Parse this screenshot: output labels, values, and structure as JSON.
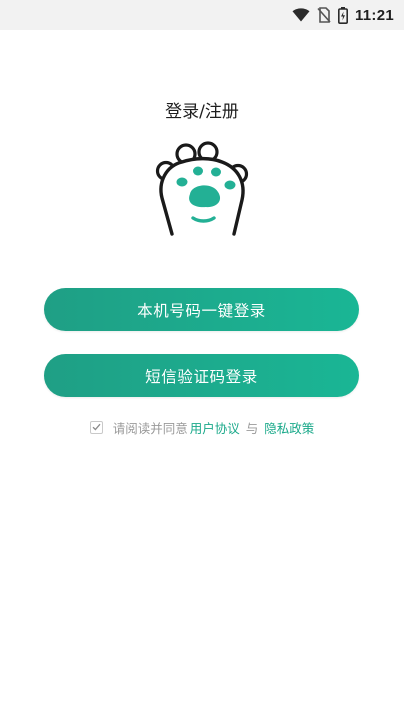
{
  "status_bar": {
    "time": "11:21",
    "icons": [
      "wifi-icon",
      "no-sim-icon",
      "battery-icon"
    ]
  },
  "page": {
    "title": "登录/注册",
    "logo_icon": "cat-paw-icon"
  },
  "buttons": {
    "one_click_login": "本机号码一键登录",
    "sms_login": "短信验证码登录"
  },
  "agreement": {
    "checked": true,
    "prefix": "请阅读并同意",
    "user_agreement": "用户协议",
    "connector": "与",
    "privacy_policy": "隐私政策"
  },
  "colors": {
    "accent": "#1aa98a",
    "button_gradient_start": "#1f9f85",
    "button_gradient_end": "#1ab695",
    "paw_pad": "#23b095",
    "text_muted": "#9a9a9a"
  }
}
